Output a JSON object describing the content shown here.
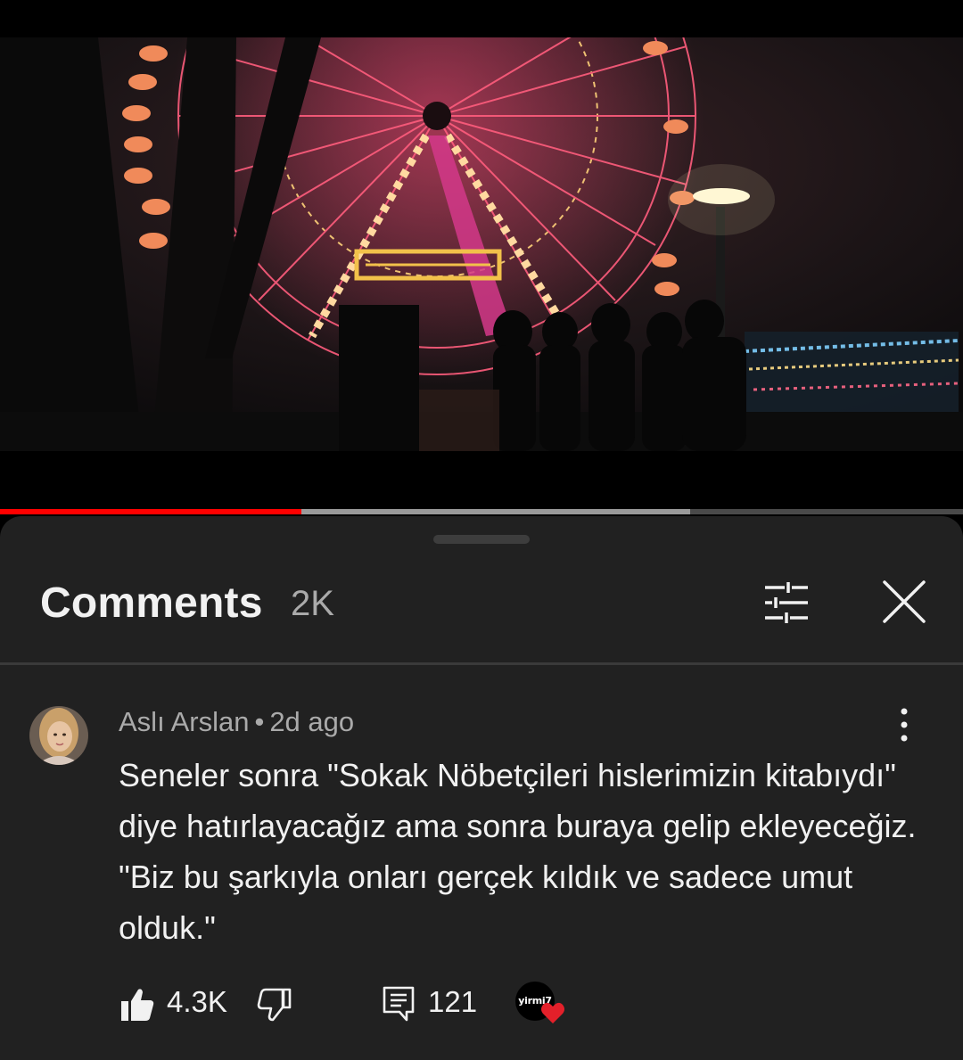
{
  "video": {
    "progress_played": 0.313,
    "progress_buffered": 0.717
  },
  "comments_panel": {
    "title": "Comments",
    "count": "2K",
    "filter_icon": "sort-filter-icon",
    "close_icon": "close-icon"
  },
  "comment": {
    "author": "Aslı Arslan",
    "separator": "•",
    "time_ago": "2d ago",
    "text": "Seneler sonra \"Sokak Nöbetçileri hislerimizin kitabıydı\" diye hatırlayacağız ama sonra buraya gelip ekleyeceğiz. \"Biz bu şarkıyla onları gerçek kıldık ve sadece umut olduk.\"",
    "likes": "4.3K",
    "replies": "121",
    "creator_heart_channel": "yirmi7",
    "heart_color": "#e3202a"
  },
  "colors": {
    "sheet_bg": "#212121",
    "progress_played": "#ff0000",
    "secondary_text": "#aaaaaa"
  }
}
